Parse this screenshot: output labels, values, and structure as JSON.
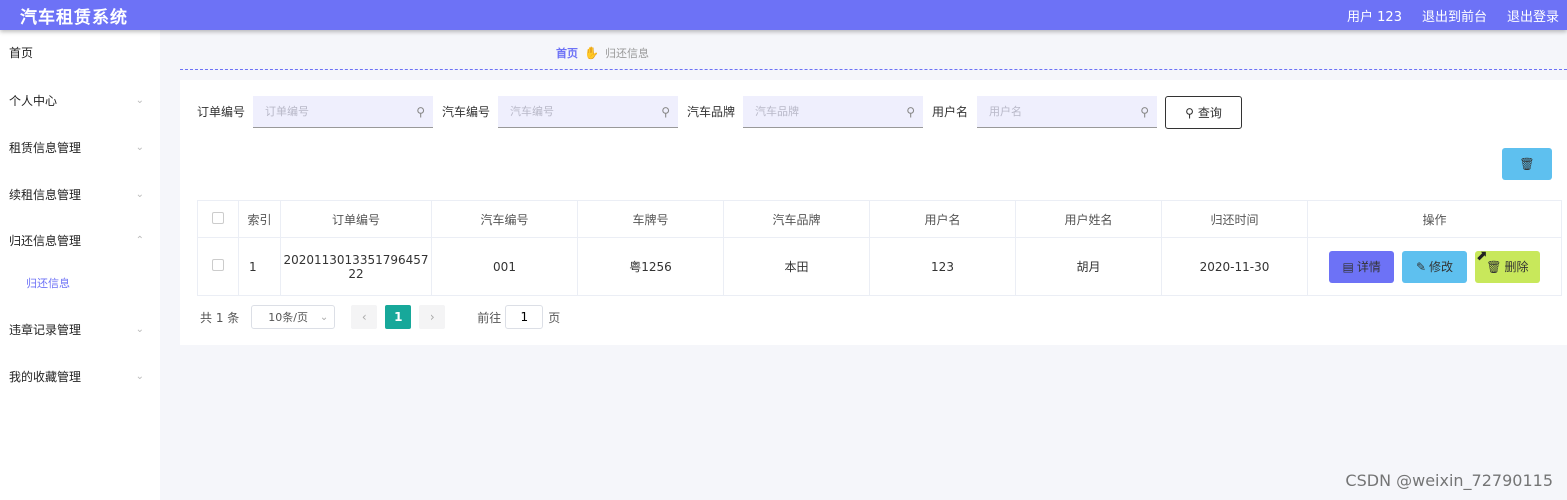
{
  "header": {
    "title": "汽车租赁系统",
    "user": "用户 123",
    "back_to_front": "退出到前台",
    "logout": "退出登录"
  },
  "sidebar": {
    "items": [
      {
        "label": "首页",
        "has_arrow": false
      },
      {
        "label": "个人中心",
        "has_arrow": true
      },
      {
        "label": "租赁信息管理",
        "has_arrow": true
      },
      {
        "label": "续租信息管理",
        "has_arrow": true
      },
      {
        "label": "归还信息管理",
        "has_arrow": true,
        "expanded": true
      },
      {
        "label": "违章记录管理",
        "has_arrow": true
      },
      {
        "label": "我的收藏管理",
        "has_arrow": true
      }
    ],
    "submenu": {
      "label": "归还信息"
    }
  },
  "breadcrumb": {
    "home": "首页",
    "current": "归还信息"
  },
  "filters": {
    "order_no": {
      "label": "订单编号",
      "placeholder": "订单编号"
    },
    "car_no": {
      "label": "汽车编号",
      "placeholder": "汽车编号"
    },
    "brand": {
      "label": "汽车品牌",
      "placeholder": "汽车品牌"
    },
    "username": {
      "label": "用户名",
      "placeholder": "用户名"
    },
    "query_button": "查询"
  },
  "table": {
    "columns": [
      "索引",
      "订单编号",
      "汽车编号",
      "车牌号",
      "汽车品牌",
      "用户名",
      "用户姓名",
      "归还时间",
      "操作"
    ],
    "rows": [
      {
        "index": "1",
        "order_no_line1": "2020113013351796457",
        "order_no_line2": "22",
        "car_no": "001",
        "plate": "粤1256",
        "brand": "本田",
        "username": "123",
        "name": "胡月",
        "return_time": "2020-11-30"
      }
    ],
    "actions": {
      "detail": "详情",
      "edit": "修改",
      "delete": "删除"
    }
  },
  "pagination": {
    "total": "共 1 条",
    "page_size": "10条/页",
    "current_page": "1",
    "goto_label": "前往",
    "goto_value": "1",
    "page_suffix": "页"
  },
  "watermark": "CSDN @weixin_72790115",
  "colors": {
    "accent": "#6d72f6",
    "edit": "#5ec0ef",
    "delete": "#c8e85b",
    "pager_active": "#17a89a"
  }
}
